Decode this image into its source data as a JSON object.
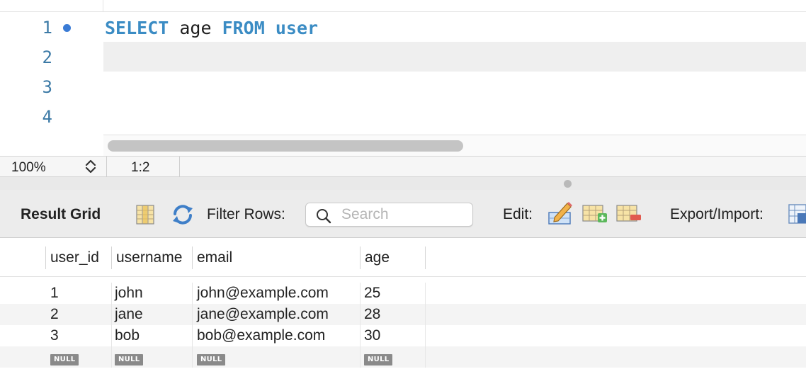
{
  "editor": {
    "lines": [
      {
        "number": "1",
        "tokens": [
          {
            "text": "SELECT",
            "kw": true
          },
          {
            "text": " age ",
            "kw": false
          },
          {
            "text": "FROM",
            "kw": true
          },
          {
            "text": " user",
            "kw": true
          }
        ]
      },
      {
        "number": "2",
        "tokens": []
      },
      {
        "number": "3",
        "tokens": []
      },
      {
        "number": "4",
        "tokens": []
      }
    ],
    "keyword_color": "#3b8cc4",
    "line_number_color": "#3c7aa6"
  },
  "status": {
    "zoom": "100%",
    "cursor": "1:2"
  },
  "toolbar": {
    "title": "Result Grid",
    "filter_label": "Filter Rows:",
    "search_placeholder": "Search",
    "search_value": "",
    "edit_label": "Edit:",
    "export_label": "Export/Import:"
  },
  "grid": {
    "columns": [
      "user_id",
      "username",
      "email",
      "age"
    ],
    "rows": [
      [
        "1",
        "john",
        "john@example.com",
        "25"
      ],
      [
        "2",
        "jane",
        "jane@example.com",
        "28"
      ],
      [
        "3",
        "bob",
        "bob@example.com",
        "30"
      ]
    ],
    "null_row": [
      "NULL",
      "NULL",
      "NULL",
      "NULL"
    ]
  },
  "icons": {
    "form_editor": "form-editor-icon",
    "refresh": "refresh-icon",
    "search": "search-icon",
    "edit_cell": "edit-cell-icon",
    "add_row": "add-row-icon",
    "delete_row": "delete-row-icon",
    "export_import": "export-import-icon"
  }
}
